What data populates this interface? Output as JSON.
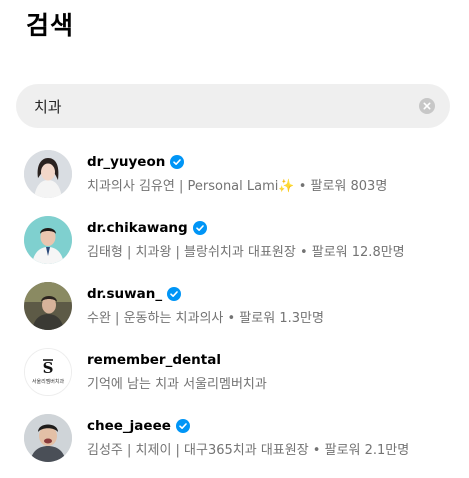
{
  "page": {
    "title": "검색"
  },
  "search": {
    "value": "치과"
  },
  "results": [
    {
      "username": "dr_yuyeon",
      "verified": true,
      "subtitle": "치과의사 김유연 | Personal Lami✨ • 팔로워 803명"
    },
    {
      "username": "dr.chikawang",
      "verified": true,
      "subtitle": "김태형 | 치과왕 | 블랑쉬치과 대표원장 • 팔로워 12.8만명"
    },
    {
      "username": "dr.suwan_",
      "verified": true,
      "subtitle": "수완 | 운동하는 치과의사 • 팔로워 1.3만명"
    },
    {
      "username": "remember_dental",
      "verified": false,
      "subtitle": "기억에 남는 치과 서울리멤버치과",
      "avatar_text": "서울리멤버치과"
    },
    {
      "username": "chee_jaeee",
      "verified": true,
      "subtitle": "김성주 | 치제이 | 대구365치과 대표원장 • 팔로워 2.1만명"
    }
  ],
  "colors": {
    "verified": "#0095f6",
    "secondary_text": "#737373",
    "search_bg": "#efefef"
  }
}
